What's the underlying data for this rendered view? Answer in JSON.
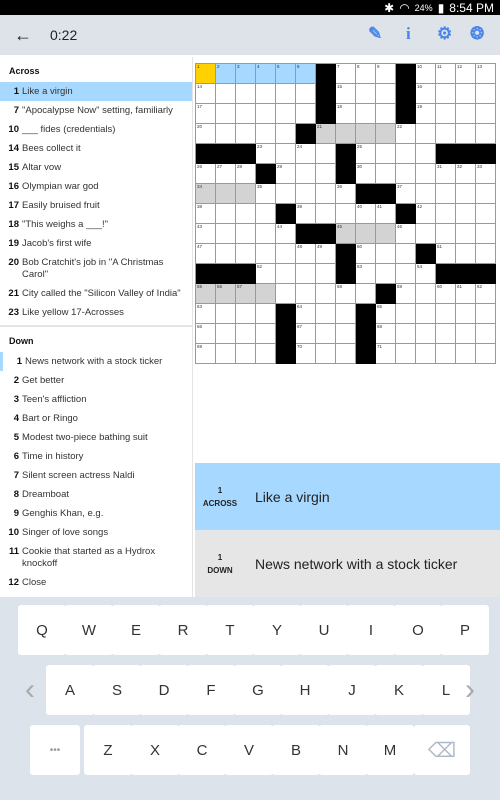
{
  "status": {
    "time": "8:54 PM",
    "battery": "24%",
    "icons": [
      "bluetooth-icon",
      "wifi-icon",
      "battery-icon"
    ]
  },
  "toolbar": {
    "back": "←",
    "timer": "0:22",
    "icons": [
      "pencil-icon",
      "info-icon",
      "gear-icon",
      "puzzle-menu-icon"
    ]
  },
  "colors": {
    "selected_clue": "#a7d8ff",
    "cursor": "#ffd100",
    "related": "#d3d3d3",
    "toolbar_icon": "#4a86e8"
  },
  "across_title": "Across",
  "across": [
    {
      "n": "1",
      "t": "Like a virgin",
      "sel": true
    },
    {
      "n": "7",
      "t": "\"Apocalypse Now\" setting, familiarly"
    },
    {
      "n": "10",
      "t": "___ fides (credentials)"
    },
    {
      "n": "14",
      "t": "Bees collect it"
    },
    {
      "n": "15",
      "t": "Altar vow"
    },
    {
      "n": "16",
      "t": "Olympian war god"
    },
    {
      "n": "17",
      "t": "Easily bruised fruit"
    },
    {
      "n": "18",
      "t": "\"This weighs a ___!\""
    },
    {
      "n": "19",
      "t": "Jacob's first wife"
    },
    {
      "n": "20",
      "t": "Bob Cratchit's job in \"A Christmas Carol\""
    },
    {
      "n": "21",
      "t": "City called the \"Silicon Valley of India\""
    },
    {
      "n": "23",
      "t": "Like yellow 17-Acrosses"
    }
  ],
  "down_title": "Down",
  "down": [
    {
      "n": "1",
      "t": "News network with a stock ticker",
      "ref": true
    },
    {
      "n": "2",
      "t": "Get better"
    },
    {
      "n": "3",
      "t": "Teen's affliction"
    },
    {
      "n": "4",
      "t": "Bart or Ringo"
    },
    {
      "n": "5",
      "t": "Modest two-piece bathing suit"
    },
    {
      "n": "6",
      "t": "Time in history"
    },
    {
      "n": "7",
      "t": "Silent screen actress Naldi"
    },
    {
      "n": "8",
      "t": "Dreamboat"
    },
    {
      "n": "9",
      "t": "Genghis Khan, e.g."
    },
    {
      "n": "10",
      "t": "Singer of love songs"
    },
    {
      "n": "11",
      "t": "Cookie that started as a Hydrox knockoff"
    },
    {
      "n": "12",
      "t": "Close"
    }
  ],
  "grid": {
    "cells": [
      [
        "1",
        "2",
        "3",
        "4",
        "5",
        "6",
        "#",
        "7",
        "8",
        "9",
        "#",
        "10",
        "11",
        "12",
        "13"
      ],
      [
        "14",
        "",
        "",
        "",
        "",
        "",
        "#",
        "15",
        "",
        "",
        "#",
        "16",
        "",
        "",
        ""
      ],
      [
        "17",
        "",
        "",
        "",
        "",
        "",
        "#",
        "18",
        "",
        "",
        "#",
        "19",
        "",
        "",
        ""
      ],
      [
        "20",
        "",
        "",
        "",
        "",
        "#",
        "21",
        "",
        "",
        "",
        "22",
        "",
        "",
        "",
        ""
      ],
      [
        "#",
        "#",
        "#",
        "23",
        "",
        "24",
        "",
        "#",
        "25",
        "",
        "",
        "",
        "#",
        "#",
        "#"
      ],
      [
        "26",
        "27",
        "28",
        "#",
        "29",
        "",
        "",
        "#",
        "30",
        "",
        "",
        "",
        "31",
        "32",
        "33"
      ],
      [
        "34",
        "",
        "",
        "35",
        "",
        "",
        "",
        "36",
        "#",
        "#",
        "37",
        "",
        "",
        "",
        ""
      ],
      [
        "38",
        "",
        "",
        "",
        "#",
        "39",
        "",
        "",
        "40",
        "41",
        "#",
        "42",
        "",
        "",
        ""
      ],
      [
        "43",
        "",
        "",
        "",
        "44",
        "#",
        "#",
        "45",
        "",
        "",
        "46",
        "",
        "",
        "",
        ""
      ],
      [
        "47",
        "",
        "",
        "",
        "",
        "48",
        "49",
        "#",
        "50",
        "",
        "",
        "#",
        "51",
        "",
        ""
      ],
      [
        "#",
        "#",
        "#",
        "52",
        "",
        "",
        "",
        "#",
        "53",
        "",
        "",
        "54",
        "#",
        "#",
        "#"
      ],
      [
        "55",
        "56",
        "57",
        "",
        "",
        "",
        "",
        "58",
        "",
        "#",
        "59",
        "",
        "60",
        "61",
        "62"
      ],
      [
        "63",
        "",
        "",
        "",
        "#",
        "64",
        "",
        "",
        "#",
        "65",
        "",
        "",
        "",
        "",
        ""
      ],
      [
        "66",
        "",
        "",
        "",
        "#",
        "67",
        "",
        "",
        "#",
        "68",
        "",
        "",
        "",
        "",
        ""
      ],
      [
        "69",
        "",
        "",
        "",
        "#",
        "70",
        "",
        "",
        "#",
        "71",
        "",
        "",
        "",
        "",
        ""
      ]
    ],
    "highlight": [
      "ybbbbb.........",
      ".............",
      "...............",
      "......gggg.....",
      "...............",
      "...............",
      "ggg............",
      "...............",
      ".......ggg.....",
      "...............",
      "...............",
      "gggg...........",
      "...............",
      "...............",
      "..............."
    ]
  },
  "active_across": {
    "num": "1",
    "dir": "ACROSS",
    "text": "Like a virgin"
  },
  "active_down": {
    "num": "1",
    "dir": "DOWN",
    "text": "News network with a stock ticker"
  },
  "keyboard": {
    "row1": [
      "Q",
      "W",
      "E",
      "R",
      "T",
      "Y",
      "U",
      "I",
      "O",
      "P"
    ],
    "row2": [
      "A",
      "S",
      "D",
      "F",
      "G",
      "H",
      "J",
      "K",
      "L"
    ],
    "row3": [
      "Z",
      "X",
      "C",
      "V",
      "B",
      "N",
      "M"
    ],
    "prev": "‹",
    "next": "›",
    "more": "•••",
    "backspace": "⌫"
  }
}
